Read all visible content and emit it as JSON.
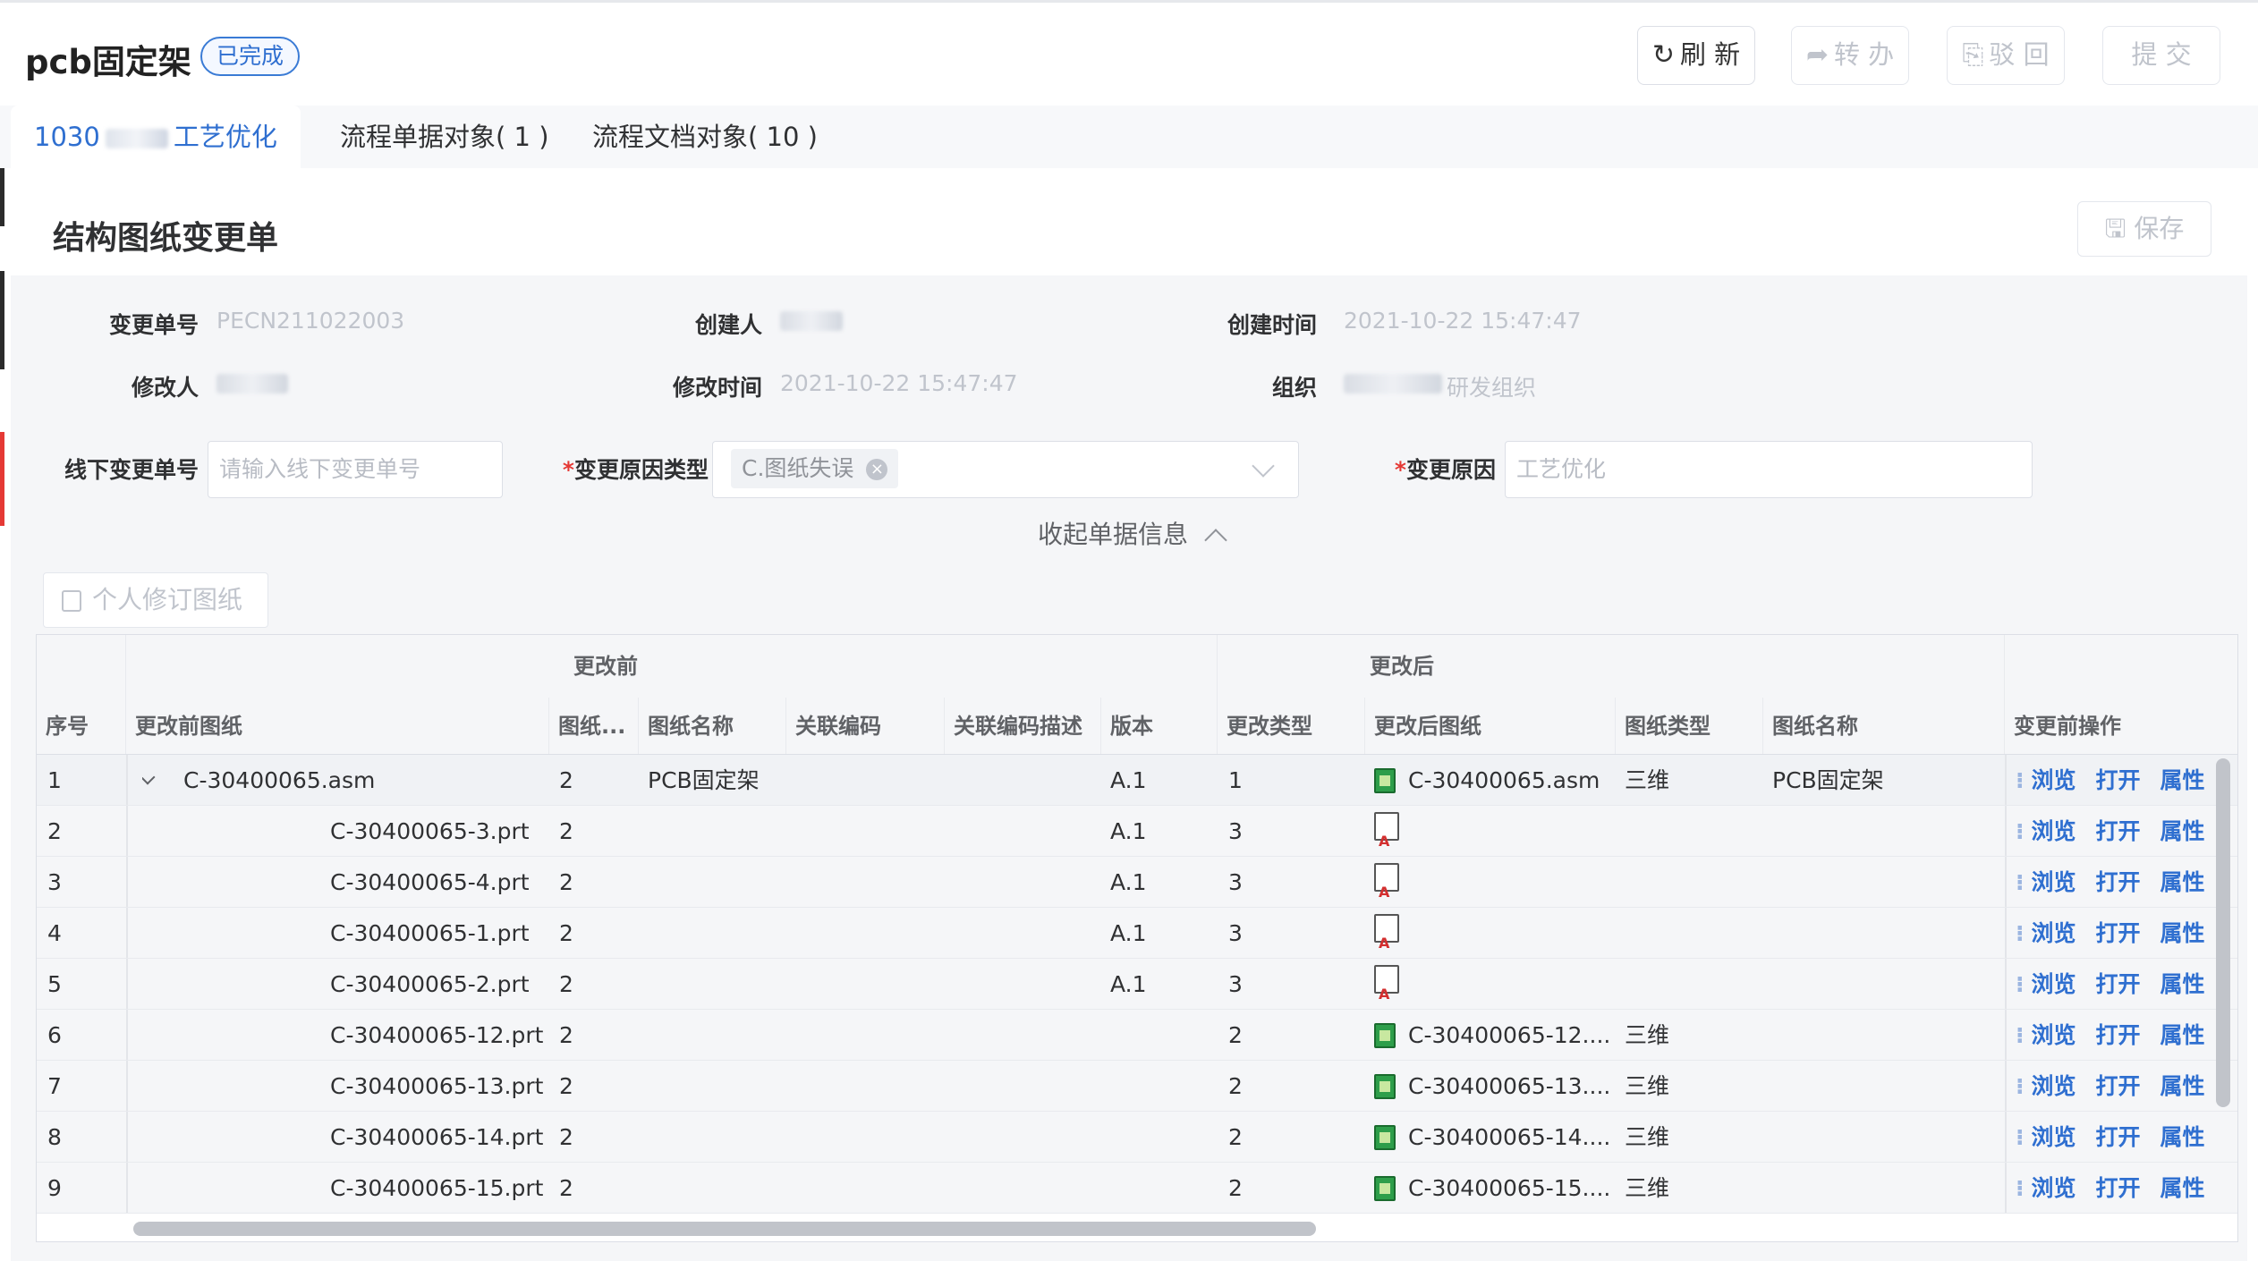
{
  "header": {
    "title": "pcb固定架",
    "status_badge": "已完成",
    "buttons": {
      "refresh": "刷 新",
      "transfer": "转 办",
      "reject": "驳 回",
      "submit": "提 交"
    }
  },
  "tabs": [
    {
      "label_prefix": "1030",
      "label_suffix": "工艺优化",
      "active": true
    },
    {
      "label": "流程单据对象( 1 )"
    },
    {
      "label": "流程文档对象( 10 )"
    }
  ],
  "card": {
    "title": "结构图纸变更单",
    "save_label": "保存"
  },
  "form": {
    "change_no_label": "变更单号",
    "change_no_value": "PECN211022003",
    "creator_label": "创建人",
    "created_time_label": "创建时间",
    "created_time_value": "2021-10-22 15:47:47",
    "modifier_label": "修改人",
    "modified_time_label": "修改时间",
    "modified_time_value": "2021-10-22 15:47:47",
    "org_label": "组织",
    "org_value_suffix": "研发组织",
    "offline_no_label": "线下变更单号",
    "offline_no_placeholder": "请输入线下变更单号",
    "reason_type_label": "变更原因类型",
    "reason_type_chip": "C.图纸失误",
    "reason_label": "变更原因",
    "reason_value": "工艺优化",
    "required_mark": "*",
    "collapse_label": "收起单据信息"
  },
  "revise_button": "个人修订图纸",
  "table": {
    "group_before": "更改前",
    "group_after": "更改后",
    "columns": [
      "序号",
      "更改前图纸",
      "图纸...",
      "图纸名称",
      "关联编码",
      "关联编码描述",
      "版本",
      "更改类型",
      "更改后图纸",
      "图纸类型",
      "图纸名称",
      "变更前操作"
    ],
    "actions": [
      "浏览",
      "打开",
      "属性"
    ],
    "rows": [
      {
        "no": "1",
        "drawing": "C-30400065.asm",
        "qty": "2",
        "name": "PCB固定架",
        "ver": "A.1",
        "ctype": "1",
        "after": "C-30400065.asm",
        "dtype": "三维",
        "aname": "PCB固定架",
        "icon": "file"
      },
      {
        "no": "2",
        "drawing": "C-30400065-3.prt",
        "qty": "2",
        "name": "",
        "ver": "A.1",
        "ctype": "3",
        "after": "",
        "dtype": "",
        "aname": "",
        "icon": "doc"
      },
      {
        "no": "3",
        "drawing": "C-30400065-4.prt",
        "qty": "2",
        "name": "",
        "ver": "A.1",
        "ctype": "3",
        "after": "",
        "dtype": "",
        "aname": "",
        "icon": "doc"
      },
      {
        "no": "4",
        "drawing": "C-30400065-1.prt",
        "qty": "2",
        "name": "",
        "ver": "A.1",
        "ctype": "3",
        "after": "",
        "dtype": "",
        "aname": "",
        "icon": "doc"
      },
      {
        "no": "5",
        "drawing": "C-30400065-2.prt",
        "qty": "2",
        "name": "",
        "ver": "A.1",
        "ctype": "3",
        "after": "",
        "dtype": "",
        "aname": "",
        "icon": "doc"
      },
      {
        "no": "6",
        "drawing": "C-30400065-12.prt",
        "qty": "2",
        "name": "",
        "ver": "",
        "ctype": "2",
        "after": "C-30400065-12....",
        "dtype": "三维",
        "aname": "",
        "icon": "file"
      },
      {
        "no": "7",
        "drawing": "C-30400065-13.prt",
        "qty": "2",
        "name": "",
        "ver": "",
        "ctype": "2",
        "after": "C-30400065-13....",
        "dtype": "三维",
        "aname": "",
        "icon": "file"
      },
      {
        "no": "8",
        "drawing": "C-30400065-14.prt",
        "qty": "2",
        "name": "",
        "ver": "",
        "ctype": "2",
        "after": "C-30400065-14....",
        "dtype": "三维",
        "aname": "",
        "icon": "file"
      },
      {
        "no": "9",
        "drawing": "C-30400065-15.prt",
        "qty": "2",
        "name": "",
        "ver": "",
        "ctype": "2",
        "after": "C-30400065-15....",
        "dtype": "三维",
        "aname": "",
        "icon": "file"
      }
    ]
  }
}
